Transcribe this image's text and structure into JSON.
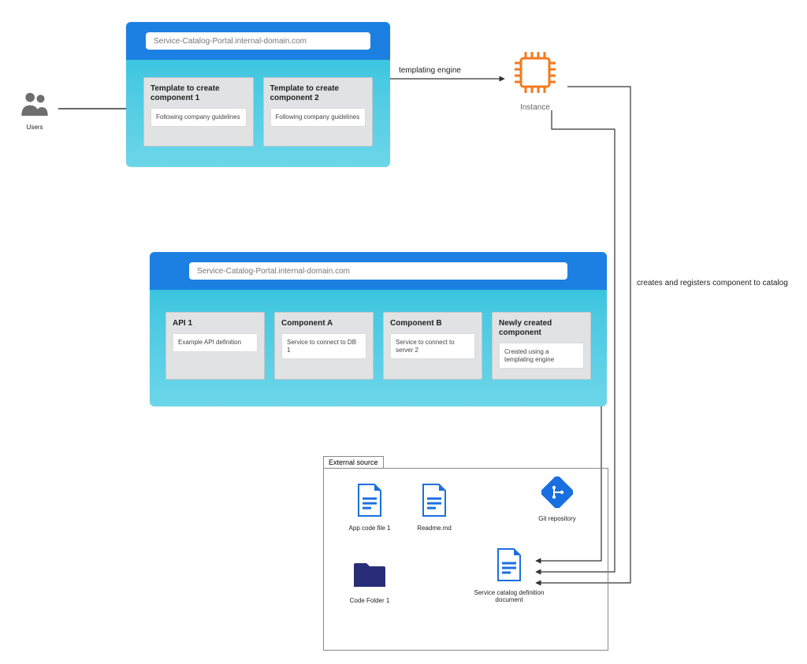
{
  "users_label": "Users",
  "instance_label": "Instance",
  "edge_templating": "templating engine",
  "edge_creates": "creates and registers component to catalog",
  "portal1": {
    "address": "Service-Catalog-Portal.internal-domain.com",
    "cards": [
      {
        "title": "Template to create component 1",
        "sub": "Following company guidelines"
      },
      {
        "title": "Template to create component 2",
        "sub": "Following company guidelines"
      }
    ]
  },
  "portal2": {
    "address": "Service-Catalog-Portal.internal-domain.com",
    "cards": [
      {
        "title": "API 1",
        "sub": "Example API definition"
      },
      {
        "title": "Component A",
        "sub": "Service to connect to DB 1"
      },
      {
        "title": "Component B",
        "sub": "Service to connect to server 2"
      },
      {
        "title": "Newly created component",
        "sub": "Created using a templating engine"
      }
    ]
  },
  "external": {
    "title": "External source",
    "items": {
      "app_code": "App code  file 1",
      "readme": "Readme.md",
      "git": "Git repository",
      "folder": "Code Folder 1",
      "catalog_doc": "Service catalog definition document"
    }
  },
  "colors": {
    "orange": "#f37a1f",
    "blue": "#1a6fe0",
    "darknavy": "#2a2e78",
    "panel_header": "#1c80e3",
    "panel_body_top": "#1fbdd9"
  }
}
